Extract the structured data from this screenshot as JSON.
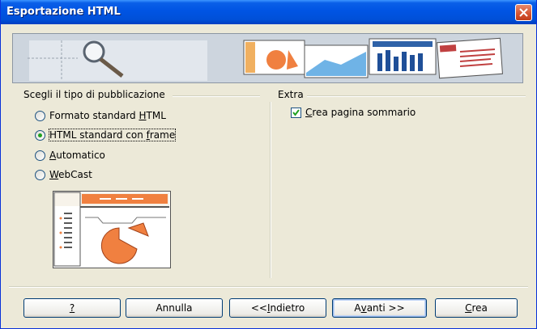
{
  "window": {
    "title": "Esportazione HTML"
  },
  "publication_group": {
    "label": "Scegli il tipo di pubblicazione",
    "options": [
      {
        "pre": "Formato standard ",
        "key": "H",
        "post": "TML",
        "selected": false
      },
      {
        "pre": "HTML standard con ",
        "key": "f",
        "post": "rame",
        "selected": true
      },
      {
        "pre": "",
        "key": "A",
        "post": "utomatico",
        "selected": false
      },
      {
        "pre": "",
        "key": "W",
        "post": "ebCast",
        "selected": false
      }
    ]
  },
  "extra_group": {
    "label": "Extra",
    "checkbox": {
      "pre": "",
      "key": "C",
      "post": "rea pagina sommario",
      "checked": true
    }
  },
  "buttons": {
    "help": {
      "pre": "",
      "key": "?",
      "post": ""
    },
    "cancel": {
      "label": "Annulla"
    },
    "back": {
      "pre": "<< ",
      "key": "I",
      "post": "ndietro"
    },
    "next": {
      "pre": "A",
      "key": "v",
      "post": "anti >>"
    },
    "create": {
      "pre": "",
      "key": "C",
      "post": "rea"
    }
  },
  "colors": {
    "titlebar": "#0054e3",
    "accent_orange": "#f08040",
    "dialog_bg": "#ece9d8"
  }
}
